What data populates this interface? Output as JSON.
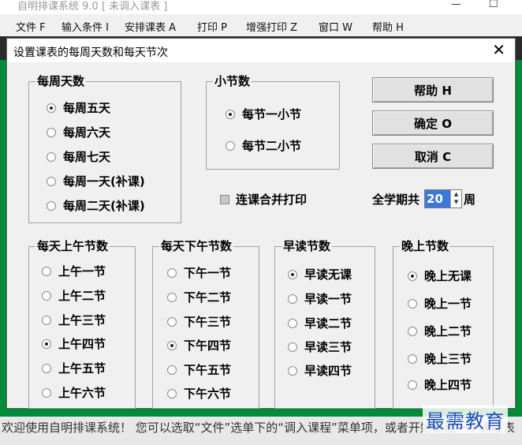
{
  "app": {
    "title": "自明排课系统 9.0 [ 未调入课表 ]"
  },
  "menu": [
    "文件 F",
    "输入条件 I",
    "安排课表 A",
    "打印 P",
    "增强打印 Z",
    "窗口 W",
    "帮助 H"
  ],
  "status_text": "欢迎使用自明排课系统！ 您可以选取“文件”选单下的“调入课程”菜单项，或者开始新建一个课程表",
  "watermark": "最需教育",
  "dialog": {
    "title": "设置课表的每周天数和每天节次",
    "days_group": {
      "label": "每周天数",
      "options": [
        "每周五天",
        "每周六天",
        "每周七天",
        "每周一天(补课)",
        "每周二天(补课)"
      ],
      "selected": 0
    },
    "periods_group": {
      "label": "小节数",
      "options": [
        "每节一小节",
        "每节二小节"
      ],
      "selected": 0
    },
    "buttons": {
      "help": "帮助 H",
      "ok": "确定 O",
      "cancel": "取消 C"
    },
    "merge_print": {
      "label": "连课合并打印",
      "checked": false
    },
    "semester": {
      "label": "全学期共",
      "value": "20",
      "unit": "周"
    },
    "morning_group": {
      "label": "每天上午节数",
      "options": [
        "上午一节",
        "上午二节",
        "上午三节",
        "上午四节",
        "上午五节",
        "上午六节"
      ],
      "selected": 3
    },
    "afternoon_group": {
      "label": "每天下午节数",
      "options": [
        "下午一节",
        "下午二节",
        "下午三节",
        "下午四节",
        "下午五节",
        "下午六节"
      ],
      "selected": 3
    },
    "early_group": {
      "label": "早读节数",
      "options": [
        "早读无课",
        "早读一节",
        "早读二节",
        "早读三节",
        "早读四节"
      ],
      "selected": 0
    },
    "evening_group": {
      "label": "晚上节数",
      "options": [
        "晚上无课",
        "晚上一节",
        "晚上二节",
        "晚上三节",
        "晚上四节"
      ],
      "selected": 0
    }
  }
}
